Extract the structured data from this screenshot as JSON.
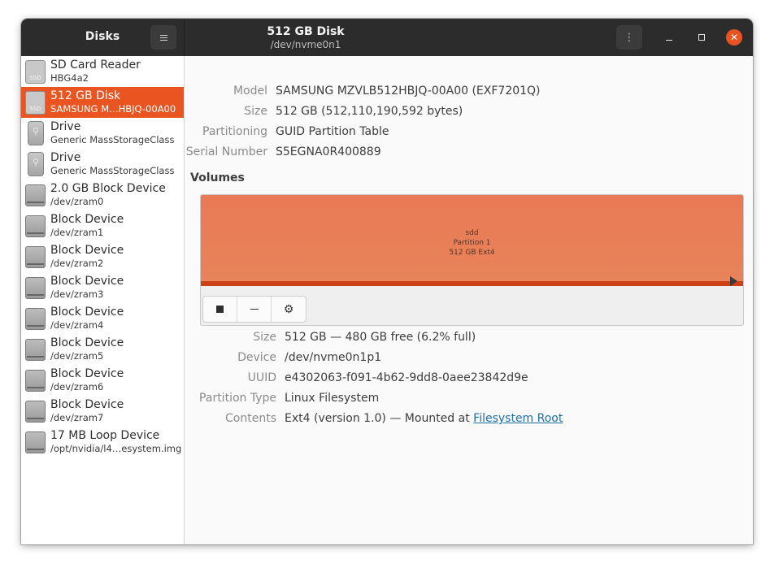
{
  "header": {
    "app_title": "Disks",
    "title": "512 GB Disk",
    "subtitle": "/dev/nvme0n1",
    "close_glyph": "✕",
    "kebab_glyph": "⋮"
  },
  "sidebar": {
    "items": [
      {
        "name": "SD Card Reader",
        "sub": "HBG4a2",
        "icon": "ssd-drive-icon",
        "icon_text": "SSD"
      },
      {
        "name": "512 GB Disk",
        "sub": "SAMSUNG M…HBJQ-00A00",
        "icon": "ssd-drive-icon",
        "icon_text": "SSD",
        "selected": true
      },
      {
        "name": "Drive",
        "sub": "Generic MassStorageClass",
        "icon": "usb-drive-icon",
        "icon_text": "⚲"
      },
      {
        "name": "Drive",
        "sub": "Generic MassStorageClass",
        "icon": "usb-drive-icon",
        "icon_text": "⚲"
      },
      {
        "name": "2.0 GB Block Device",
        "sub": "/dev/zram0",
        "icon": "block-device-icon"
      },
      {
        "name": "Block Device",
        "sub": "/dev/zram1",
        "icon": "block-device-icon"
      },
      {
        "name": "Block Device",
        "sub": "/dev/zram2",
        "icon": "block-device-icon"
      },
      {
        "name": "Block Device",
        "sub": "/dev/zram3",
        "icon": "block-device-icon"
      },
      {
        "name": "Block Device",
        "sub": "/dev/zram4",
        "icon": "block-device-icon"
      },
      {
        "name": "Block Device",
        "sub": "/dev/zram5",
        "icon": "block-device-icon"
      },
      {
        "name": "Block Device",
        "sub": "/dev/zram6",
        "icon": "block-device-icon"
      },
      {
        "name": "Block Device",
        "sub": "/dev/zram7",
        "icon": "block-device-icon"
      },
      {
        "name": "17 MB Loop Device",
        "sub": "/opt/nvidia/l4…esystem.img",
        "icon": "block-device-icon"
      }
    ]
  },
  "disk_info": {
    "model_label": "Model",
    "model_value": "SAMSUNG MZVLB512HBJQ-00A00 (EXF7201Q)",
    "size_label": "Size",
    "size_value": "512 GB (512,110,190,592 bytes)",
    "partitioning_label": "Partitioning",
    "partitioning_value": "GUID Partition Table",
    "serial_label": "Serial Number",
    "serial_value": "S5EGNA0R400889"
  },
  "volumes": {
    "title": "Volumes",
    "partition_line1": "sdd",
    "partition_line2": "Partition 1",
    "partition_line3": "512 GB Ext4"
  },
  "partition_info": {
    "size_label": "Size",
    "size_value": "512 GB — 480 GB free (6.2% full)",
    "device_label": "Device",
    "device_value": "/dev/nvme0n1p1",
    "uuid_label": "UUID",
    "uuid_value": "e4302063-f091-4b62-9dd8-0aee23842d9e",
    "type_label": "Partition Type",
    "type_value": "Linux Filesystem",
    "contents_label": "Contents",
    "contents_value": "Ext4 (version 1.0) — Mounted at ",
    "contents_link": "Filesystem Root"
  },
  "colors": {
    "accent": "#e95420",
    "partition_fill": "#e8805a",
    "header_bg": "#2c2c2c"
  }
}
